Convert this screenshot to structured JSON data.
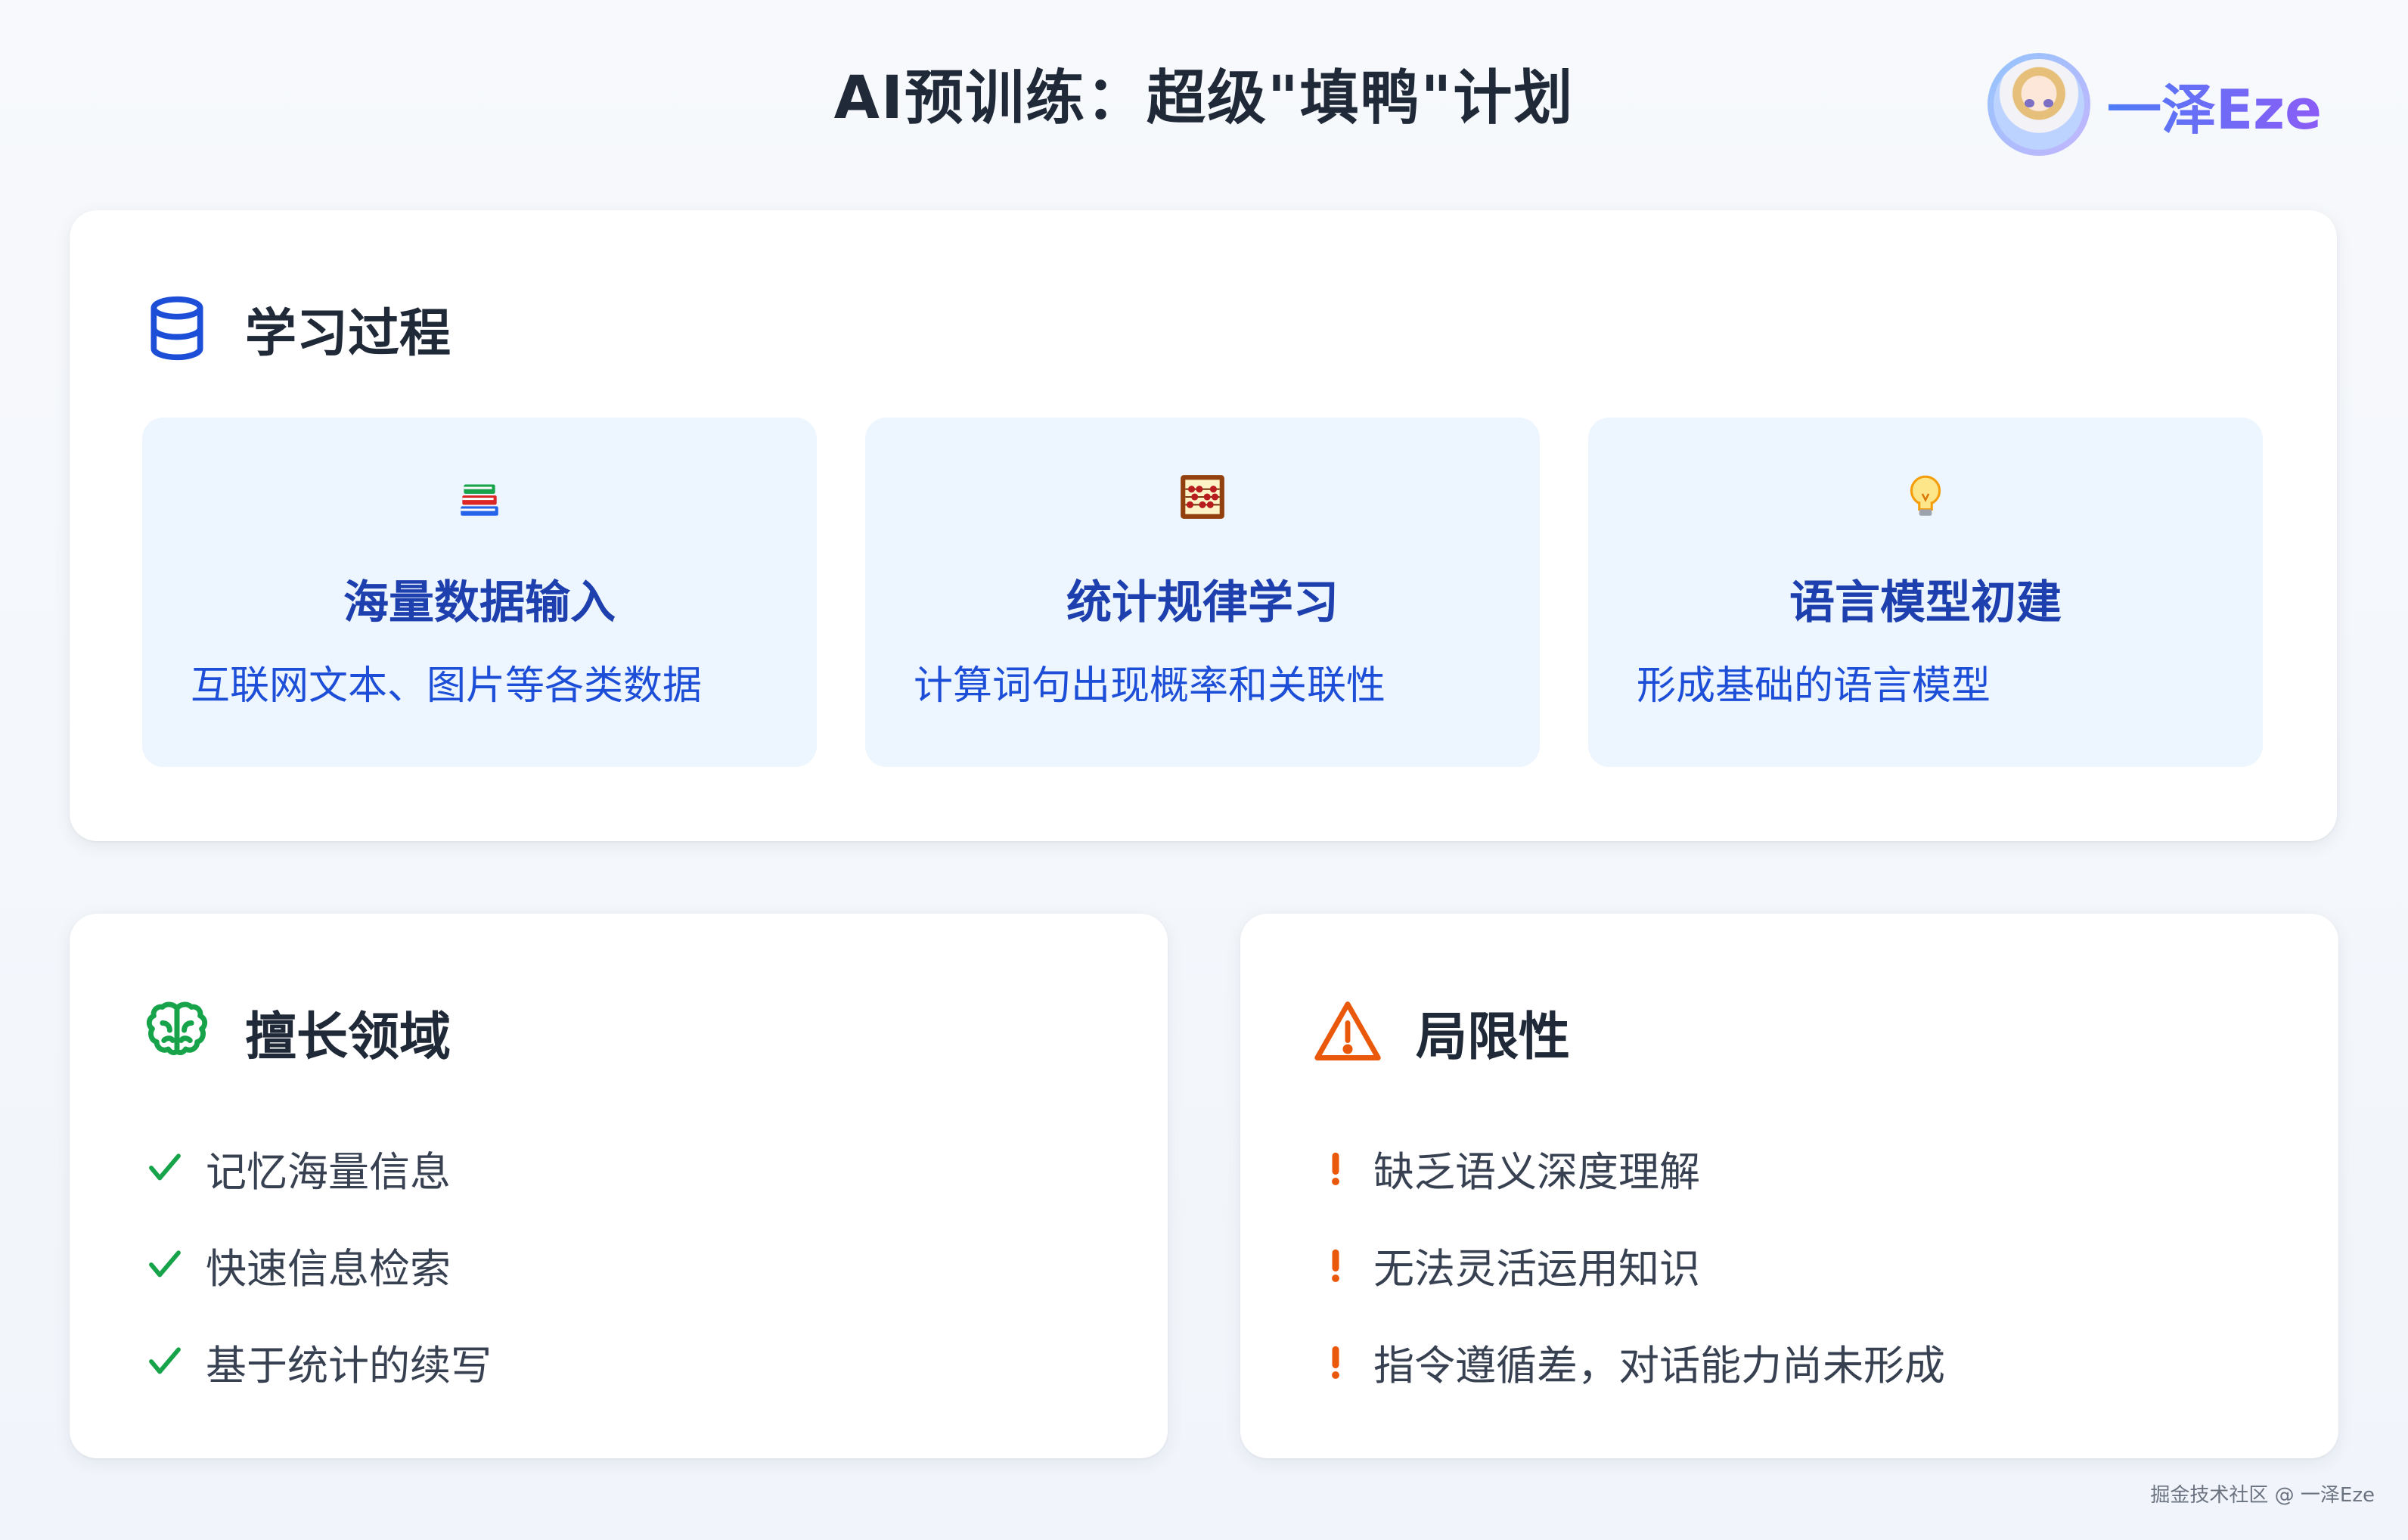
{
  "header": {
    "title": "AI预训练：超级\"填鸭\"计划",
    "brand_name": "一泽Eze",
    "avatar_icon": "anime-avatar"
  },
  "learning": {
    "title": "学习过程",
    "icon": "database-icon",
    "steps": [
      {
        "icon": "books-icon",
        "title": "海量数据输入",
        "desc": "互联网文本、图片等各类数据"
      },
      {
        "icon": "abacus-icon",
        "title": "统计规律学习",
        "desc": "计算词句出现概率和关联性"
      },
      {
        "icon": "lightbulb-icon",
        "title": "语言模型初建",
        "desc": "形成基础的语言模型"
      }
    ]
  },
  "strengths": {
    "title": "擅长领域",
    "icon": "brain-icon",
    "items": [
      "记忆海量信息",
      "快速信息检索",
      "基于统计的续写"
    ]
  },
  "limitations": {
    "title": "局限性",
    "icon": "warning-icon",
    "items": [
      "缺乏语义深度理解",
      "无法灵活运用知识",
      "指令遵循差，对话能力尚未形成"
    ]
  },
  "footer": {
    "watermark": "掘金技术社区 @ 一泽Eze"
  },
  "colors": {
    "primary_blue": "#1d4ed8",
    "success_green": "#16a34a",
    "warning_orange": "#ea580c",
    "step_bg": "#edf5fe"
  }
}
